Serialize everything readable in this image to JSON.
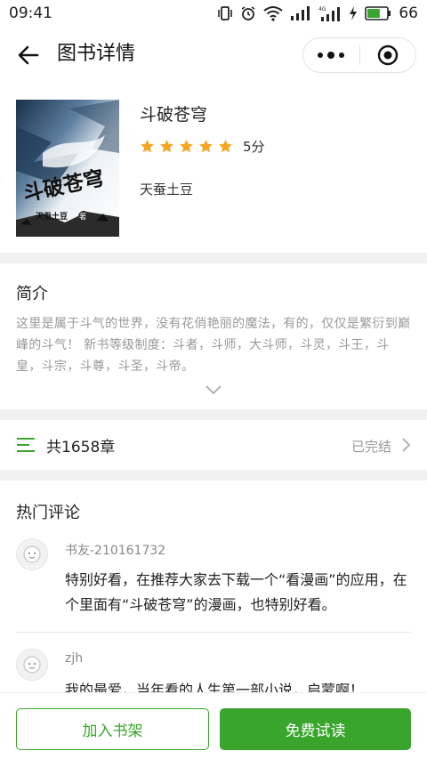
{
  "status_bar": {
    "time": "09:41",
    "network": "4G",
    "battery": "66",
    "icons": [
      "vibrate-icon",
      "alarm-icon",
      "wifi-icon",
      "signal-icon",
      "signal-4g-icon",
      "charging-icon",
      "battery-icon"
    ]
  },
  "navbar": {
    "title": "图书详情",
    "back_icon": "arrow-left-icon",
    "more_icon": "more-dots-icon",
    "close_icon": "target-close-icon"
  },
  "book": {
    "title": "斗破苍穹",
    "rating": 5,
    "rating_max": 5,
    "score_label": "5分",
    "author": "天蚕土豆",
    "cover_title": "斗破苍穹",
    "cover_author": "天蚕土豆",
    "cover_author_seal": "著"
  },
  "intro": {
    "heading": "简介",
    "text": "这里是属于斗气的世界，没有花俏艳丽的魔法，有的，仅仅是繁衍到巅峰的斗气！ 新书等级制度：斗者，斗师，大斗师，斗灵，斗王，斗皇，斗宗，斗尊，斗圣，斗帝。"
  },
  "chapters": {
    "label": "共1658章",
    "status": "已完结"
  },
  "comments": {
    "heading": "热门评论",
    "items": [
      {
        "user": "书友-210161732",
        "text": "特别好看，在推荐大家去下载一个“看漫画”的应用，在个里面有“斗破苍穹”的漫画，也特别好看。"
      },
      {
        "user": "zjh",
        "text": "我的最爱，当年看的人生第一部小说，启蒙啊！"
      }
    ]
  },
  "bottom_bar": {
    "add_shelf": "加入书架",
    "free_read": "免费试读"
  },
  "colors": {
    "accent_green": "#3aa52d",
    "star": "#f5a623",
    "muted_text": "#999999"
  }
}
